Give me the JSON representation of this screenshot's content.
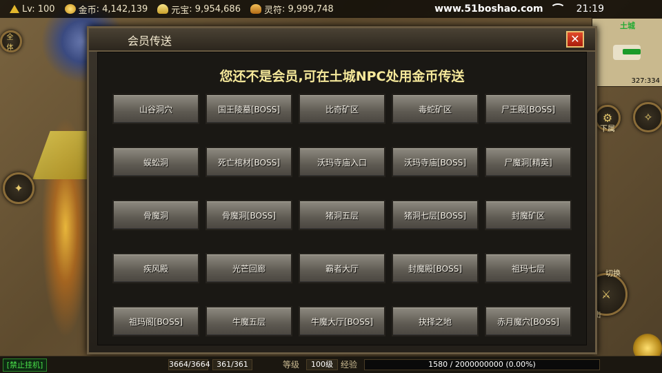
{
  "status_bar": {
    "level": "Lv: 100",
    "gold_label": "金币",
    "gold_value": "4,142,139",
    "yuanbao_label": "元宝",
    "yuanbao_value": "9,954,686",
    "lingfu_label": "灵符",
    "lingfu_value": "9,999,748",
    "site": "www.51boshao.com",
    "time": "21:19"
  },
  "minimap": {
    "map_name": "土城",
    "coords": "327:334"
  },
  "side": {
    "left_top_btn": "全体",
    "right_btn_label": "下属",
    "attack_label": "攻击",
    "toggle_label": "切换"
  },
  "dialog": {
    "title": "会员传送",
    "close": "✕",
    "notice": "您还不是会员,可在土城NPC处用金币传送",
    "destinations": [
      [
        "山谷洞穴",
        "国王陵墓[BOSS]",
        "比奇矿区",
        "毒蛇矿区",
        "尸王殿[BOSS]"
      ],
      [
        "蜈蚣洞",
        "死亡棺材[BOSS]",
        "沃玛寺庙入口",
        "沃玛寺庙[BOSS]",
        "尸魔洞[精英]"
      ],
      [
        "骨魔洞",
        "骨魔洞[BOSS]",
        "猪洞五层",
        "猪洞七层[BOSS]",
        "封魔矿区"
      ],
      [
        "疾风殿",
        "光芒回廊",
        "霸者大厅",
        "封魔殿[BOSS]",
        "祖玛七层"
      ],
      [
        "祖玛阁[BOSS]",
        "牛魔五层",
        "牛魔大厅[BOSS]",
        "抉择之地",
        "赤月魔穴[BOSS]"
      ]
    ]
  },
  "bottom_bar": {
    "auto_hang": "[禁止挂机]",
    "hp": "3664/3664",
    "mp": "361/361",
    "level_label": "等级",
    "level_value": "100级",
    "exp_label": "经验",
    "exp_value": "1580 / 2000000000 (0.00%)"
  }
}
